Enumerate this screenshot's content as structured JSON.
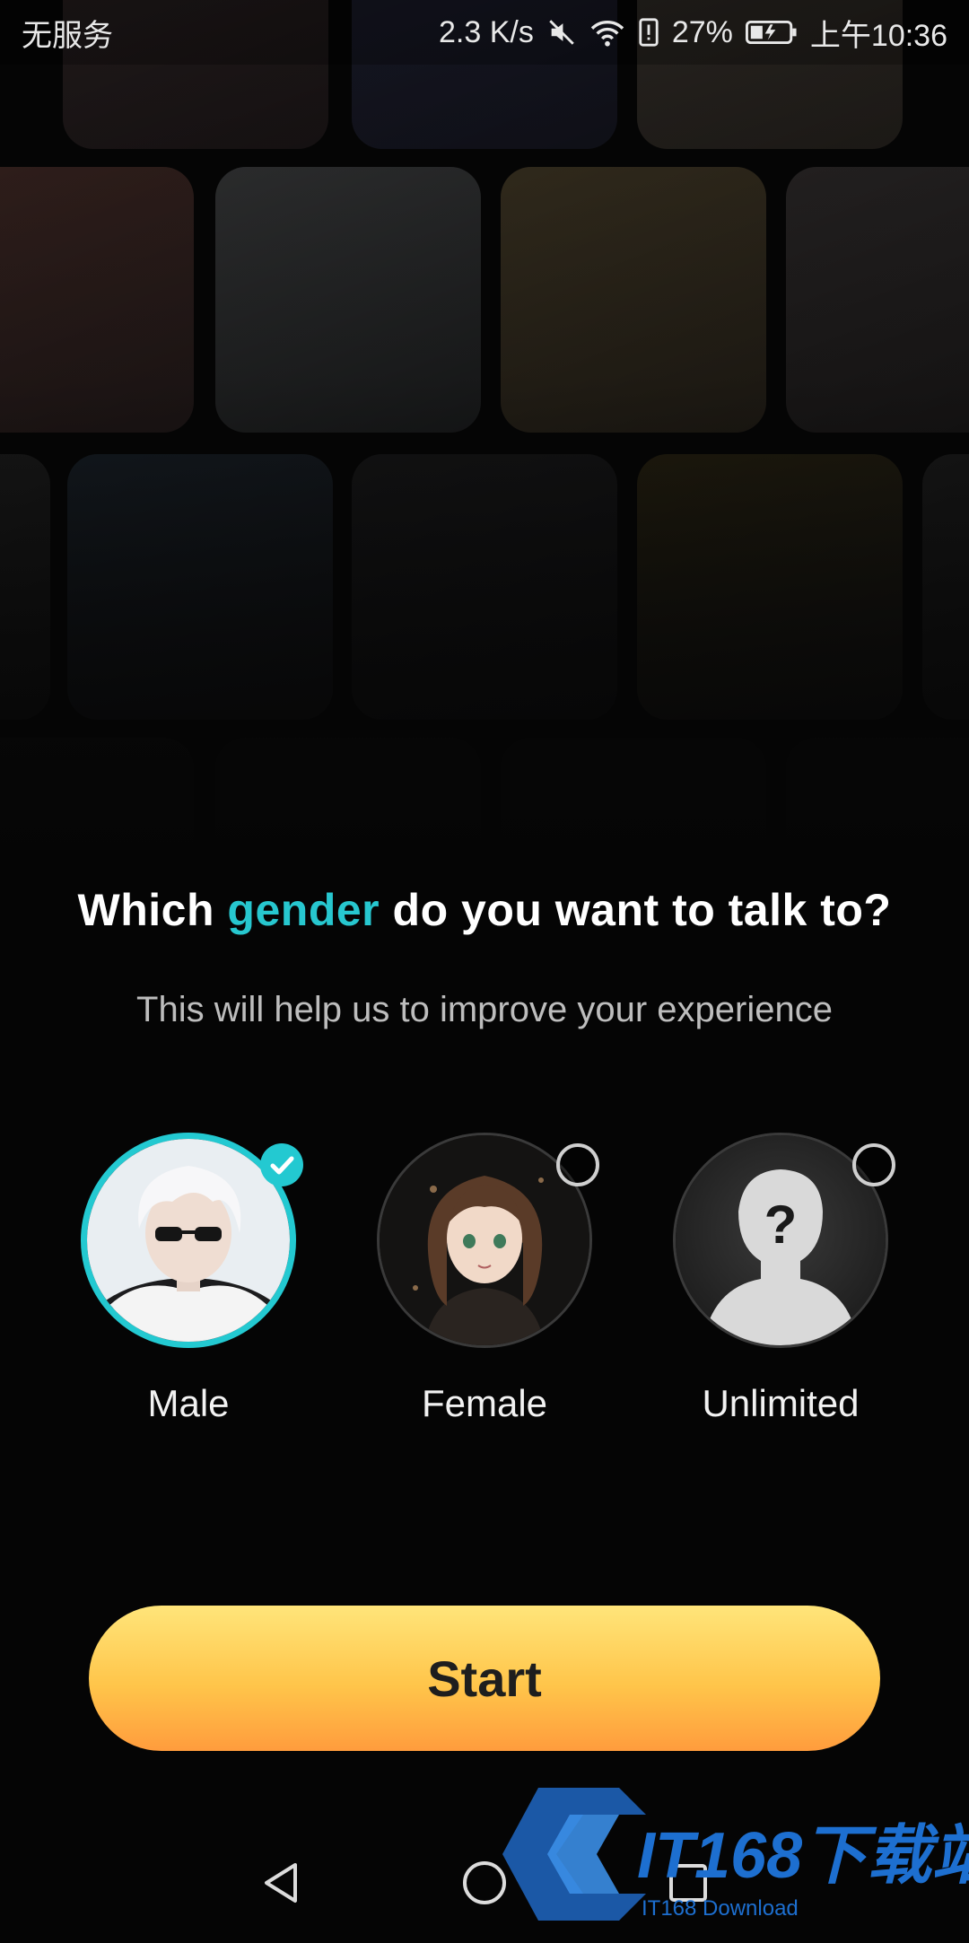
{
  "status_bar": {
    "carrier": "无服务",
    "speed": "2.3 K/s",
    "battery": "27%",
    "time": "上午10:36"
  },
  "question": {
    "prefix": "Which",
    "highlight": "gender",
    "suffix": "do you want to talk to?"
  },
  "subtitle": "This will help us to improve your experience",
  "options": [
    {
      "label": "Male",
      "selected": true,
      "avatar_icon": "male-avatar"
    },
    {
      "label": "Female",
      "selected": false,
      "avatar_icon": "female-avatar"
    },
    {
      "label": "Unlimited",
      "selected": false,
      "avatar_icon": "unknown-person-icon"
    }
  ],
  "start_button": "Start",
  "watermark": {
    "brand": "IT168下载站",
    "sub": "IT168 Download"
  },
  "colors": {
    "accent": "#27c7cf",
    "button_top": "#ffe57a",
    "button_bottom": "#ff9c3d",
    "background": "#050505"
  }
}
